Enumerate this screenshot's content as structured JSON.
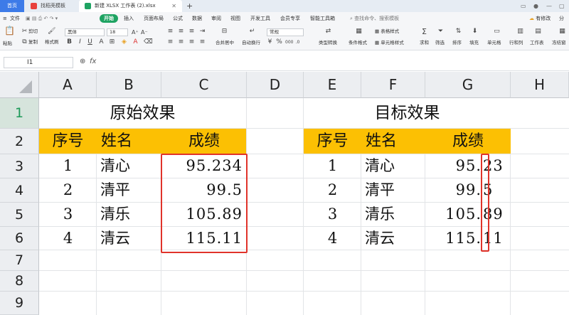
{
  "tabs": {
    "home": "首页",
    "template": "找稻壳模板",
    "file": "新建 XLSX 工作表 (2).xlsx"
  },
  "menu": [
    "文件",
    "开始",
    "插入",
    "页面布局",
    "公式",
    "数据",
    "审阅",
    "视图",
    "开发工具",
    "会员专享",
    "智能工具箱"
  ],
  "search_placeholder": "查找命令、搜索模板",
  "right_menu": {
    "modify": "有修改",
    "share": "分"
  },
  "ribbon": {
    "paste": "粘贴",
    "cut": "剪切",
    "copy": "复制",
    "format_painter": "格式刷",
    "font": "黑体",
    "font_size": "18",
    "merge": "合并居中",
    "wrap": "自动换行",
    "number_format": "常规",
    "type_convert": "类型转换",
    "cond_format": "条件格式",
    "cell_style": "单元格样式",
    "table_style": "表格样式",
    "sum": "求和",
    "filter": "筛选",
    "sort": "排序",
    "fill": "填充",
    "cell": "单元格",
    "rowcol": "行和列",
    "sheet": "工作表",
    "freeze": "冻结窗"
  },
  "formula_bar": {
    "cell_ref": "I1",
    "fx": "fx"
  },
  "columns": [
    "A",
    "B",
    "C",
    "D",
    "E",
    "F",
    "G",
    "H"
  ],
  "rows": [
    "1",
    "2",
    "3",
    "4",
    "5",
    "6",
    "7",
    "8",
    "9"
  ],
  "left_table": {
    "title": "原始效果",
    "headers": [
      "序号",
      "姓名",
      "成绩"
    ],
    "rows": [
      [
        "1",
        "清心",
        "95.234"
      ],
      [
        "2",
        "清平",
        "99.5"
      ],
      [
        "3",
        "清乐",
        "105.89"
      ],
      [
        "4",
        "清云",
        "115.11"
      ]
    ]
  },
  "right_table": {
    "title": "目标效果",
    "headers": [
      "序号",
      "姓名",
      "成绩"
    ],
    "rows": [
      [
        "1",
        "清心",
        "95.",
        "23"
      ],
      [
        "2",
        "清平",
        "99.",
        "5"
      ],
      [
        "3",
        "清乐",
        "105.",
        "89"
      ],
      [
        "4",
        "清云",
        "115.",
        "11"
      ]
    ]
  },
  "colors": {
    "header_fill": "#fcc003",
    "highlight": "#e0332a",
    "tab_accent": "#3d7be8",
    "menu_active": "#1ea362"
  }
}
